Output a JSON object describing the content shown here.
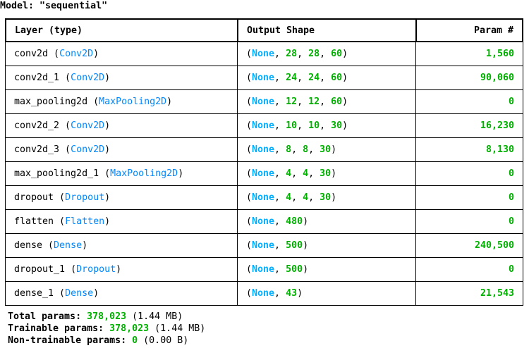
{
  "model_title": "Model: \"sequential\"",
  "headers": {
    "layer": "Layer (type)",
    "output_shape": "Output Shape",
    "params": "Param #"
  },
  "layers": [
    {
      "name": "conv2d",
      "type": "Conv2D",
      "dims": [
        "28",
        "28",
        "60"
      ],
      "params": "1,560"
    },
    {
      "name": "conv2d_1",
      "type": "Conv2D",
      "dims": [
        "24",
        "24",
        "60"
      ],
      "params": "90,060"
    },
    {
      "name": "max_pooling2d",
      "type": "MaxPooling2D",
      "dims": [
        "12",
        "12",
        "60"
      ],
      "params": "0"
    },
    {
      "name": "conv2d_2",
      "type": "Conv2D",
      "dims": [
        "10",
        "10",
        "30"
      ],
      "params": "16,230"
    },
    {
      "name": "conv2d_3",
      "type": "Conv2D",
      "dims": [
        "8",
        "8",
        "30"
      ],
      "params": "8,130"
    },
    {
      "name": "max_pooling2d_1",
      "type": "MaxPooling2D",
      "dims": [
        "4",
        "4",
        "30"
      ],
      "params": "0"
    },
    {
      "name": "dropout",
      "type": "Dropout",
      "dims": [
        "4",
        "4",
        "30"
      ],
      "params": "0"
    },
    {
      "name": "flatten",
      "type": "Flatten",
      "dims": [
        "480"
      ],
      "params": "0"
    },
    {
      "name": "dense",
      "type": "Dense",
      "dims": [
        "500"
      ],
      "params": "240,500"
    },
    {
      "name": "dropout_1",
      "type": "Dropout",
      "dims": [
        "500"
      ],
      "params": "0"
    },
    {
      "name": "dense_1",
      "type": "Dense",
      "dims": [
        "43"
      ],
      "params": "21,543"
    }
  ],
  "none_label": "None",
  "totals": {
    "total_label": "Total params:",
    "total_value": "378,023",
    "total_size": "(1.44 MB)",
    "trainable_label": "Trainable params:",
    "trainable_value": "378,023",
    "trainable_size": "(1.44 MB)",
    "nontrainable_label": "Non-trainable params:",
    "nontrainable_value": "0",
    "nontrainable_size": "(0.00 B)"
  },
  "colors": {
    "type_blue": "#0087ff",
    "none_blue": "#00afff",
    "number_green": "#00af00"
  }
}
